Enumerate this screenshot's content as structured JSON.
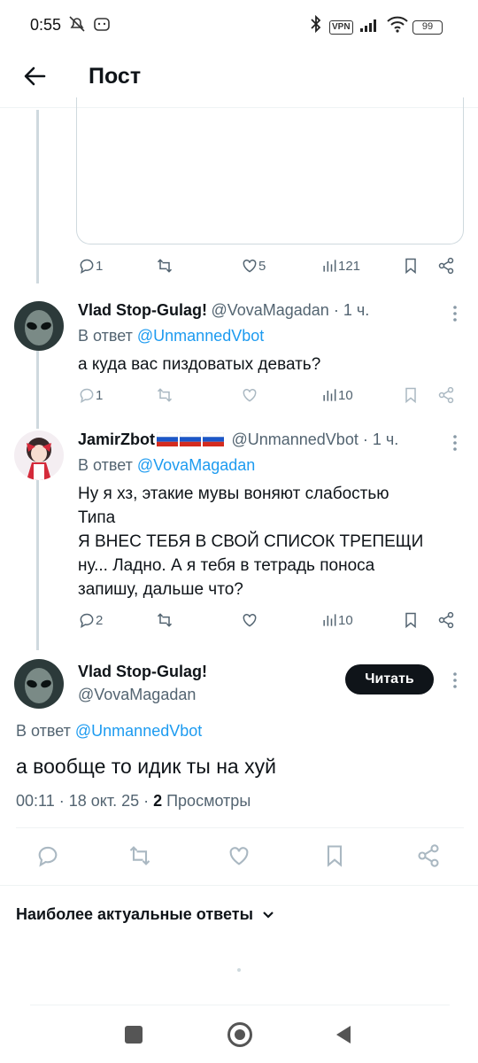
{
  "status_bar": {
    "time": "0:55",
    "battery": "99",
    "vpn": "VPN"
  },
  "header": {
    "title": "Пост"
  },
  "prev_tweet_actions": {
    "replies": "1",
    "retweets": "",
    "likes": "5",
    "views": "121"
  },
  "replies": [
    {
      "name": "Vlad Stop-Gulag!",
      "meta": "@VovaMagadan · 1 ч.",
      "reply_prefix": "В ответ ",
      "reply_to": "@UnmannedVbot",
      "text": "а куда вас пиздоватых девать?",
      "replies_count": "1",
      "likes_count": "",
      "views": "10"
    },
    {
      "name": "JamirZbot",
      "meta": "@UnmannedVbot · 1 ч.",
      "reply_prefix": "В ответ ",
      "reply_to": "@VovaMagadan",
      "text_lines": [
        "Ну я хз, этакие мувы воняют слабостью",
        "Типа",
        "Я ВНЕС ТЕБЯ В СВОЙ СПИСОК ТРЕПЕЩИ",
        "ну... Ладно. А я тебя в тетрадь поноса",
        "запишу, дальше что?"
      ],
      "replies_count": "2",
      "views": "10"
    }
  ],
  "main_tweet": {
    "name": "Vlad Stop-Gulag!",
    "handle": "@VovaMagadan",
    "follow_label": "Читать",
    "reply_prefix": "В ответ ",
    "reply_to": "@UnmannedVbot",
    "text": "а вообще то идик ты на хуй",
    "timestamp": "00:11 · 18 окт. 25 · ",
    "views_count": "2",
    "views_label": " Просмотры"
  },
  "replies_sort": {
    "label": "Наиболее актуальные ответы"
  },
  "colors": {
    "accent": "#1d9bf0",
    "text": "#0f1419",
    "muted": "#536471",
    "line": "#cfd9de"
  }
}
